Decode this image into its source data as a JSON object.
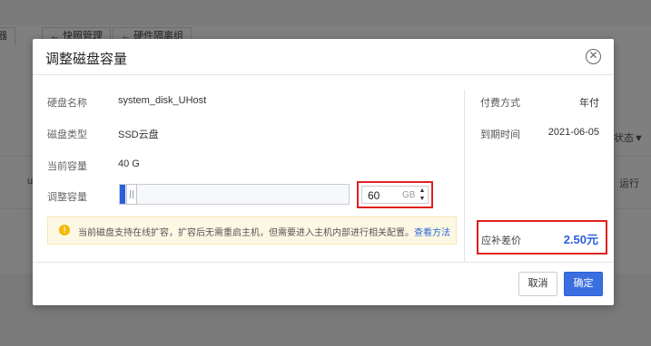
{
  "background": {
    "tabs": [
      "器",
      "快照管理",
      "硬件隔离组"
    ],
    "col_status": "状态",
    "cell_partial": "ul",
    "cell_status": "运行"
  },
  "dialog": {
    "title": "调整磁盘容量",
    "close_icon": "close-circle-icon",
    "fields": {
      "disk_name_label": "硬盘名称",
      "disk_name_value": "system_disk_UHost",
      "disk_type_label": "磁盘类型",
      "disk_type_value": "SSD云盘",
      "current_capacity_label": "当前容量",
      "current_capacity_value": "40 G",
      "adjust_capacity_label": "调整容量"
    },
    "capacity_input": {
      "value": "60",
      "unit": "GB"
    },
    "notice": {
      "icon": "warning-icon",
      "icon_glyph": "!",
      "text": "当前磁盘支持在线扩容，扩容后无需重启主机，但需要进入主机内部进行相关配置。",
      "link": "查看方法"
    },
    "summary": {
      "billing_label": "付费方式",
      "billing_value": "年付",
      "expiry_label": "到期时间",
      "expiry_value": "2021-06-05",
      "diff_label": "应补差价",
      "diff_value": "2.50元"
    },
    "buttons": {
      "cancel": "取消",
      "ok": "确定"
    }
  },
  "colors": {
    "accent": "#2b5fd9",
    "highlight_border": "#e02020",
    "notice_bg": "#fdf8e4",
    "notice_icon": "#f5b800"
  }
}
